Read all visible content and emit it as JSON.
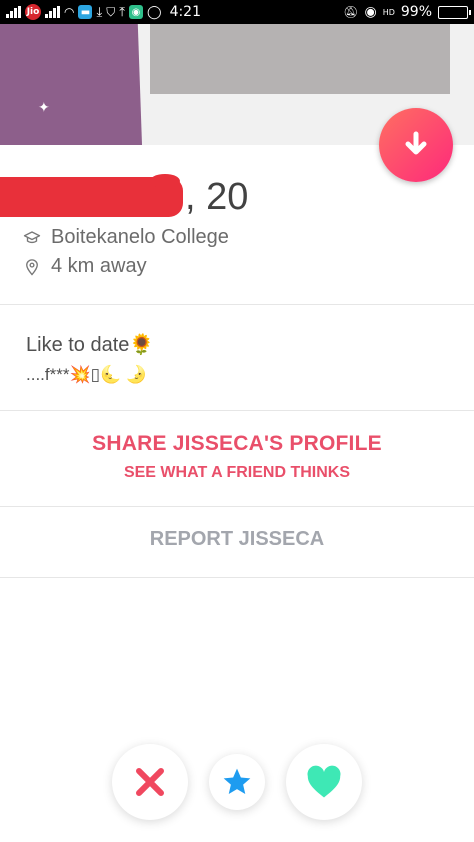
{
  "status_bar": {
    "carrier": "Jio",
    "time": "4:21",
    "hd_label": "HD",
    "battery": "99%",
    "battery_level": 0.99
  },
  "profile": {
    "age": ", 20",
    "school": "Boitekanelo College",
    "distance": "4 km away",
    "bio_line1": "Like to date🌻",
    "bio_line2": "....f***💥▯🌜  🌛"
  },
  "share": {
    "title": "SHARE JISSECA'S PROFILE",
    "subtitle": "SEE WHAT A FRIEND THINKS"
  },
  "report": {
    "label": "REPORT JISSECA"
  },
  "colors": {
    "brand_gradient_start": "#ff6f61",
    "brand_gradient_end": "#fd297b",
    "share_text": "#e94f6a",
    "report_text": "#a3a6ad",
    "nope": "#f0485f",
    "superlike": "#1e9cf0",
    "like": "#3ee8b5"
  },
  "icons": {
    "expand": "arrow-down-icon",
    "school": "graduation-cap-icon",
    "distance": "location-pin-icon",
    "nope": "close-icon",
    "superlike": "star-icon",
    "like": "heart-icon"
  }
}
